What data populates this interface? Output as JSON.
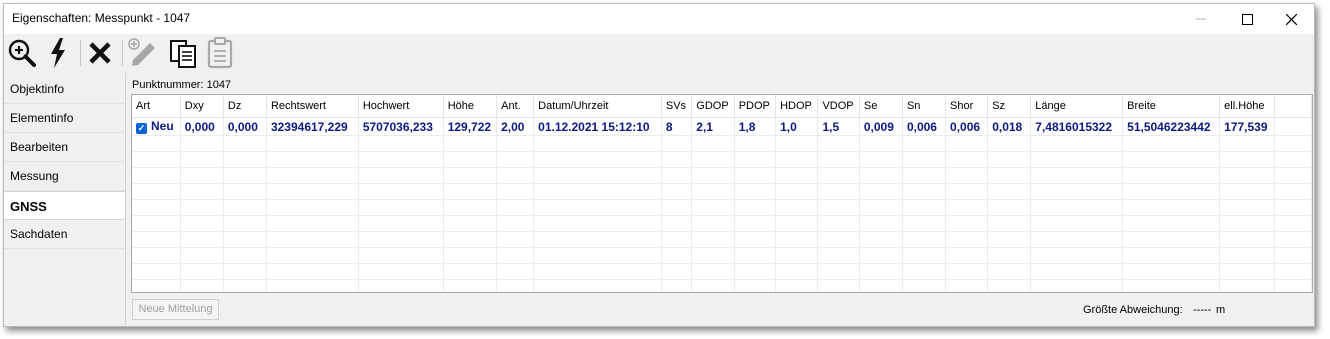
{
  "window": {
    "title": "Eigenschaften: Messpunkt - 1047"
  },
  "toolbar": {
    "buttons": [
      {
        "icon": "zoom-in-icon",
        "enabled": true
      },
      {
        "icon": "lightning-icon",
        "enabled": true
      },
      {
        "icon": "delete-x-icon",
        "enabled": true
      },
      {
        "icon": "edit-pen-icon",
        "enabled": false
      },
      {
        "icon": "copy-icon",
        "enabled": true
      },
      {
        "icon": "paste-clipboard-icon",
        "enabled": false
      }
    ]
  },
  "sidebar": {
    "tabs": [
      {
        "label": "Objektinfo"
      },
      {
        "label": "Elementinfo"
      },
      {
        "label": "Bearbeiten"
      },
      {
        "label": "Messung"
      },
      {
        "label": "GNSS"
      },
      {
        "label": "Sachdaten"
      }
    ],
    "active": "GNSS"
  },
  "panel": {
    "header": "Punktnummer: 1047",
    "columns": [
      "Art",
      "Dxy",
      "Dz",
      "Rechtswert",
      "Hochwert",
      "Höhe",
      "Ant.",
      "Datum/Uhrzeit",
      "SVs",
      "GDOP",
      "PDOP",
      "HDOP",
      "VDOP",
      "Se",
      "Sn",
      "Shor",
      "Sz",
      "Länge",
      "Breite",
      "ell.Höhe"
    ],
    "rows": [
      {
        "checked": true,
        "cells": [
          "Neu",
          "0,000",
          "0,000",
          "32394617,229",
          "5707036,233",
          "129,722",
          "2,00",
          "01.12.2021 15:12:10",
          "8",
          "2,1",
          "1,8",
          "1,0",
          "1,5",
          "0,009",
          "0,006",
          "0,006",
          "0,018",
          "7,4816015322",
          "51,5046223442",
          "177,539"
        ]
      }
    ],
    "button_label": "Neue Mittelung",
    "deviation_label": "Größte Abweichung:",
    "deviation_value": "-----",
    "deviation_unit": "m"
  },
  "colors": {
    "data_text": "#0a1a80",
    "checkbox": "#0a64d6",
    "window_bg": "#f0f0f0"
  }
}
